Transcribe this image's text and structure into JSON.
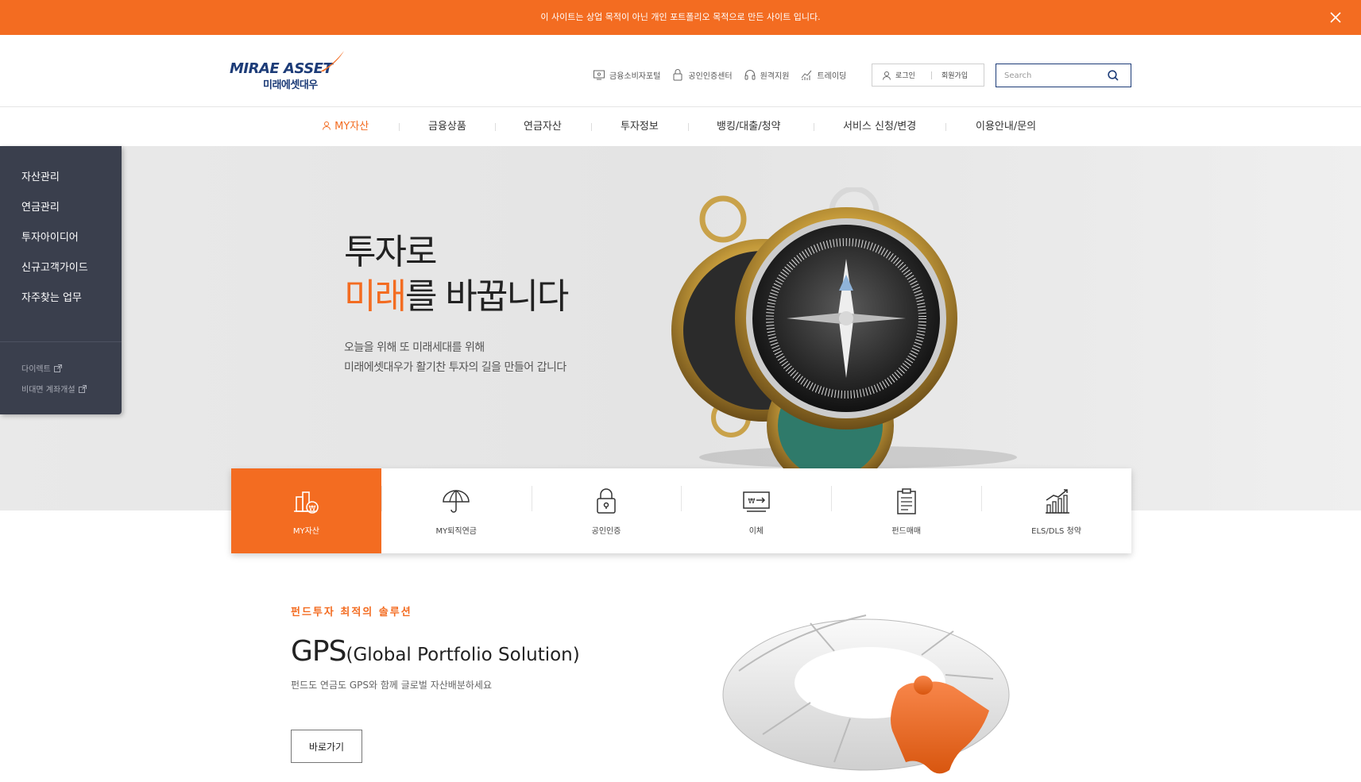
{
  "topbar": {
    "message": "이 사이트는 상업 목적이 아닌 개인 포트폴리오 목적으로 만든 사이트 입니다."
  },
  "logo": {
    "en": "MIRAE ASSET",
    "ko": "미래에셋대우"
  },
  "utility": [
    {
      "label": "금융소비자포털",
      "icon": "monitor-icon"
    },
    {
      "label": "공인인증센터",
      "icon": "lock-icon"
    },
    {
      "label": "원격지원",
      "icon": "headset-icon"
    },
    {
      "label": "트레이딩",
      "icon": "chart-icon"
    }
  ],
  "auth": {
    "login": "로그인",
    "join": "회원가입"
  },
  "search": {
    "placeholder": "Search"
  },
  "gnb": [
    {
      "label": "MY자산",
      "active": true
    },
    {
      "label": "금융상품"
    },
    {
      "label": "연금자산"
    },
    {
      "label": "투자정보"
    },
    {
      "label": "뱅킹/대출/청약"
    },
    {
      "label": "서비스 신청/변경"
    },
    {
      "label": "이용안내/문의"
    }
  ],
  "sidebar": {
    "items": [
      "자산관리",
      "연금관리",
      "투자아이디어",
      "신규고객가이드",
      "자주찾는 업무"
    ],
    "links": [
      "다이렉트",
      "비대면 계좌개설"
    ]
  },
  "hero": {
    "line1": "투자로",
    "line2_orange": "미래",
    "line2_rest": "를 바꿉니다",
    "sub1": "오늘을 위해 또 미래세대를 위해",
    "sub2": "미래에셋대우가 활기찬 투자의 길을 만들어 갑니다"
  },
  "quick": [
    {
      "label": "MY자산",
      "icon": "asset-icon",
      "active": true
    },
    {
      "label": "MY퇴직연금",
      "icon": "umbrella-icon"
    },
    {
      "label": "공인인증",
      "icon": "padlock-icon"
    },
    {
      "label": "이체",
      "icon": "transfer-icon"
    },
    {
      "label": "펀드매매",
      "icon": "clipboard-icon"
    },
    {
      "label": "ELS/DLS 청약",
      "icon": "bar-chart-icon"
    }
  ],
  "gps": {
    "kicker": "펀드투자 최적의 솔루션",
    "title": "GPS",
    "title_sub": "(Global Portfolio Solution)",
    "desc": "펀드도 연금도 GPS와 함께 글로벌 자산배분하세요",
    "button": "바로가기"
  },
  "colors": {
    "accent": "#f36c21",
    "brand": "#1d3c78",
    "sidebar": "#3a3f4d"
  }
}
